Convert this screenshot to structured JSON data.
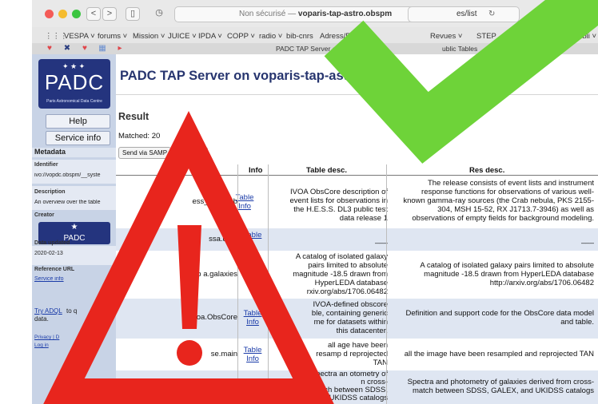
{
  "browser": {
    "address_prefix": "Non sécurisé —",
    "address_host": "voparis-tap-astro.obspm",
    "address_tail": "es/list",
    "bookmarks": [
      "VESPA ˅",
      "forums ˅",
      "Mission ˅",
      "JUICE ˅",
      "IPDA ˅",
      "COPP ˅",
      "radio ˅",
      "bib-cnrs",
      "Adress/RLR",
      "Revues ˅",
      "STEP",
      "ques ˅",
      "bibli ˅"
    ],
    "tab_title": "PADC TAP Server on vo",
    "tab_title_2": "ublic Tables"
  },
  "sidebar": {
    "logo_text": "PADC",
    "logo_subtitle": "Paris Astronomical Data Centre",
    "help_label": "Help",
    "service_info_label": "Service info",
    "metadata_heading": "Metadata",
    "identifier_label": "Identifier",
    "identifier_value": "ivo://vopdc.obspm/__syste",
    "description_label": "Description",
    "description_value": "An overview over the table",
    "creator_label": "Creator",
    "data_updated_label": "Data updated",
    "data_updated_value": "2020-02-13",
    "reference_url_label": "Reference URL",
    "reference_url_value": "Service info",
    "adql_link": "Try ADQL",
    "adql_tail": "to q",
    "adql_tail2": "data.",
    "privacy_link": "Privacy | D",
    "login_link": "Log in"
  },
  "main": {
    "page_title": "PADC TAP Server on voparis-tap-astro.ol",
    "result_heading": "Result",
    "matched": "Matched: 20",
    "send_samp_label": "Send via SAMP",
    "qu_label": "Qu",
    "columns": [
      "Tab",
      "me",
      "Info",
      "Table desc.",
      "Res desc."
    ],
    "rows": [
      {
        "name": "ess_dr.vo_ob",
        "info": [
          "Table",
          "Info"
        ],
        "table_desc": [
          "IVOA ObsCore description of",
          "event lists for observations in",
          "the H.E.S.S. DL3 public test",
          "data release 1"
        ],
        "res_desc": [
          "The release consists of event lists and instrument",
          "response functions for observations of various well-",
          "known gamma-ray sources (the Crab nebula, PKS 2155-",
          "304, MSH 15-52, RX J1713.7-3946) as well as",
          "observations of empty fields for background modeling."
        ]
      },
      {
        "name": "ssa.data",
        "info": [
          "Table",
          ""
        ],
        "table_desc": [
          "___"
        ],
        "res_desc": [
          "___"
        ]
      },
      {
        "name": "hyp a.galaxies",
        "info": [
          "Table",
          "Info"
        ],
        "table_desc": [
          "A catalog of isolated galaxy",
          "pairs limited to absolute",
          "magnitude -18.5 drawn from",
          "HyperLEDA database",
          "rxiv.org/abs/1706.06482"
        ],
        "res_desc": [
          "A catalog of isolated galaxy pairs limited to absolute",
          "magnitude -18.5 drawn from HyperLEDA database",
          "http://arxiv.org/abs/1706.06482"
        ]
      },
      {
        "name": "ivoa.ObsCore",
        "info": [
          "Table",
          "Info"
        ],
        "table_desc": [
          "IVOA-defined obscore",
          "ble, containing generic",
          "me for datasets within",
          "this datacenter."
        ],
        "res_desc": [
          "Definition and support code for the ObsCore data model",
          "and table."
        ]
      },
      {
        "name": "se.main",
        "info": [
          "Table",
          "Info"
        ],
        "table_desc": [
          "all age have been",
          "resamp d reprojected",
          "TAN"
        ],
        "res_desc": [
          "all the image have been resampled and reprojected TAN"
        ]
      },
      {
        "name": "",
        "info": [
          "",
          "Info"
        ],
        "table_desc": [
          "Spectra an otometry of",
          "n cross-",
          "match between SDSS,",
          "GALEX, and UKIDSS catalogs"
        ],
        "res_desc": [
          "Spectra and photometry of galaxies derived from cross-",
          "match between SDSS, GALEX, and UKIDSS catalogs"
        ]
      }
    ]
  },
  "overlay": {
    "warning_mark": "!",
    "warning_color": "#e8251d",
    "check_color": "#6ed339"
  }
}
